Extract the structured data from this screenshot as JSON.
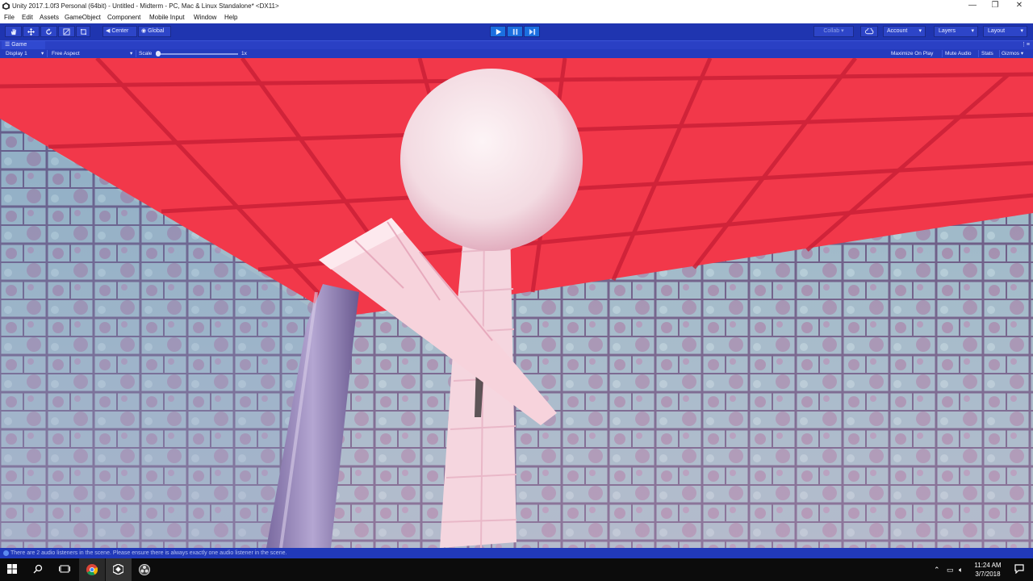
{
  "window": {
    "title": "Unity 2017.1.0f3 Personal (64bit) - Untitled - Midterm - PC, Mac & Linux Standalone* <DX11>",
    "minimize": "—",
    "maximize": "❐",
    "close": "✕"
  },
  "menu": [
    "File",
    "Edit",
    "Assets",
    "GameObject",
    "Component",
    "Mobile Input",
    "Window",
    "Help"
  ],
  "toolbar": {
    "pivot_label": "Center",
    "space_label": "Global",
    "collab_label": "Collab ▾",
    "account_label": "Account",
    "layers_label": "Layers",
    "layout_label": "Layout"
  },
  "game_view": {
    "tab_label": "Game",
    "display_label": "Display 1",
    "aspect_label": "Free Aspect",
    "scale_label": "Scale",
    "scale_value": "1x",
    "maximize_on_play": "Maximize On Play",
    "mute_audio": "Mute Audio",
    "stats": "Stats",
    "gizmos": "Gizmos ▾"
  },
  "status": {
    "message": "There are 2 audio listeners in the scene. Please ensure there is always exactly one audio listener in the scene."
  },
  "taskbar": {
    "time": "11:24 AM",
    "date": "3/7/2018"
  },
  "colors": {
    "unity_blue": "#1f35b0",
    "ceiling_red": "#f2384a",
    "wall_tile": "#8fb6c4",
    "figure_white": "#f7e4ea"
  }
}
